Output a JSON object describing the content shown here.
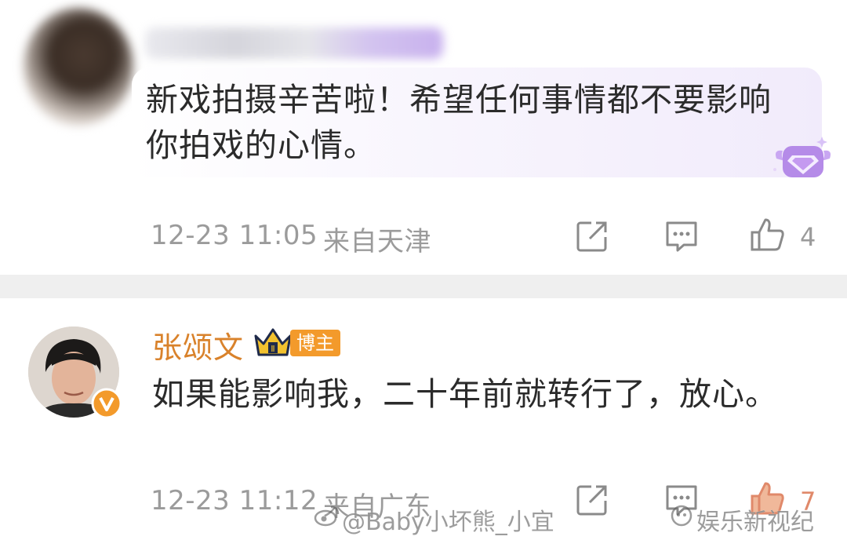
{
  "comment1": {
    "text": "新戏拍摄辛苦啦！希望任何事情都不要影响你拍戏的心情。",
    "date": "12-23 11:05",
    "location": "来自天津",
    "like_count": "4"
  },
  "comment2": {
    "username": "张颂文",
    "badge_label": "博主",
    "text": "如果能影响我，二十年前就转行了，放心。",
    "date": "12-23 11:12",
    "location": "来自广东",
    "like_count": "7"
  },
  "watermarks": {
    "weibo_handle": "@Baby小坏熊_小宜",
    "source": "娱乐新视纪"
  },
  "icons": {
    "share": "share-icon",
    "comment": "comment-icon",
    "like": "thumbs-up-icon",
    "verified": "verified-v-icon",
    "crown": "crown-icon",
    "fan_badge": "diamond-fan-badge-icon"
  },
  "colors": {
    "username": "#d9822b",
    "badge": "#f39a2b",
    "meta": "#9b9b9b",
    "divider": "#efefef"
  }
}
